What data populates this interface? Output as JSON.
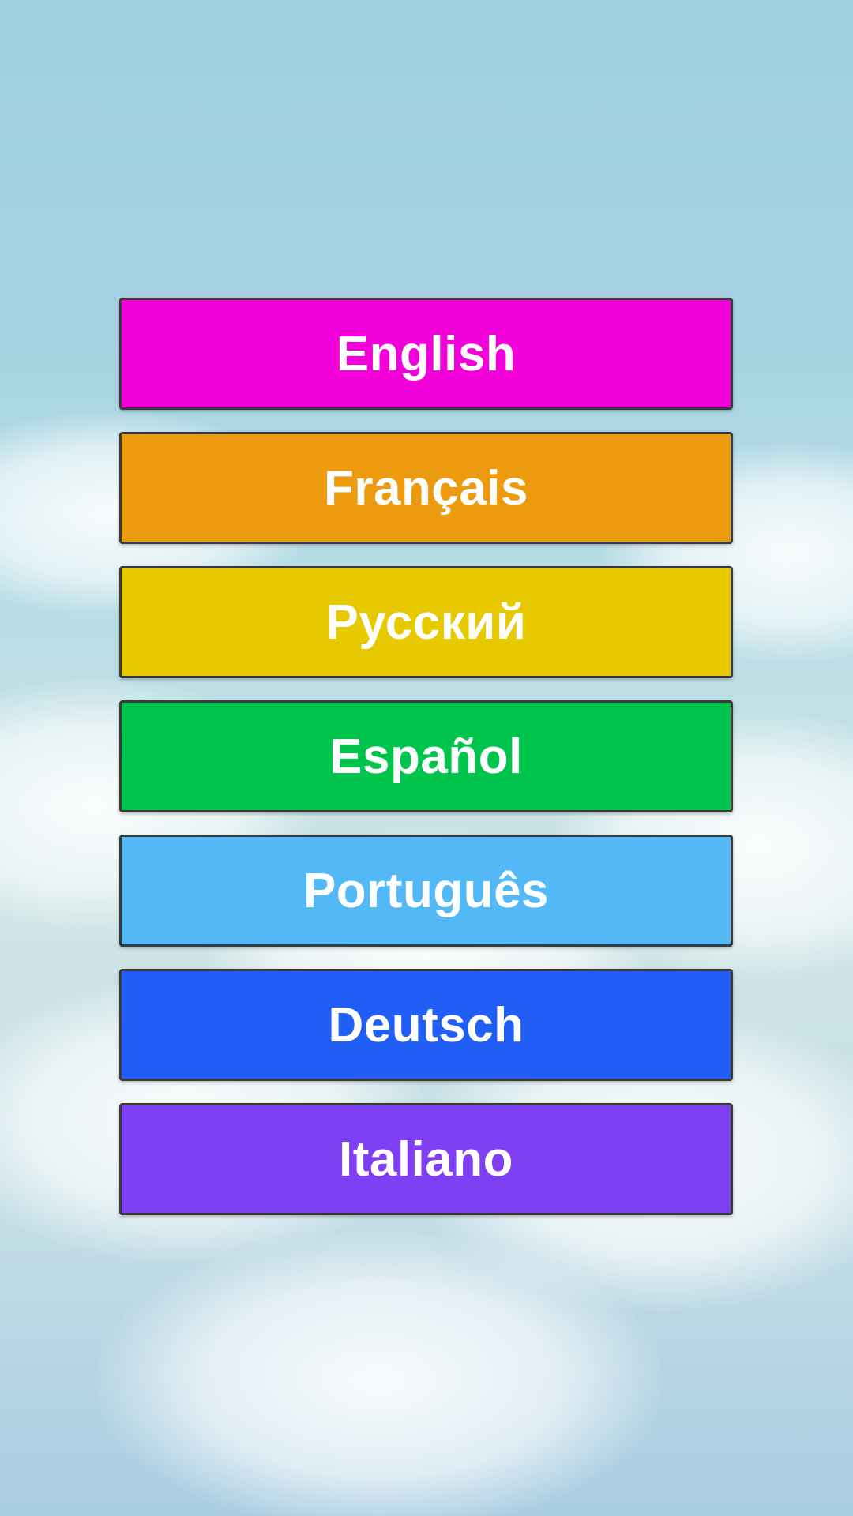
{
  "languages": [
    {
      "label": "English",
      "color": "#f200d9"
    },
    {
      "label": "Français",
      "color": "#ec9b0e"
    },
    {
      "label": "Русский",
      "color": "#e7c900"
    },
    {
      "label": "Español",
      "color": "#00c44b"
    },
    {
      "label": "Português",
      "color": "#53b8f6"
    },
    {
      "label": "Deutsch",
      "color": "#215ef5"
    },
    {
      "label": "Italiano",
      "color": "#7f3ff2"
    }
  ]
}
